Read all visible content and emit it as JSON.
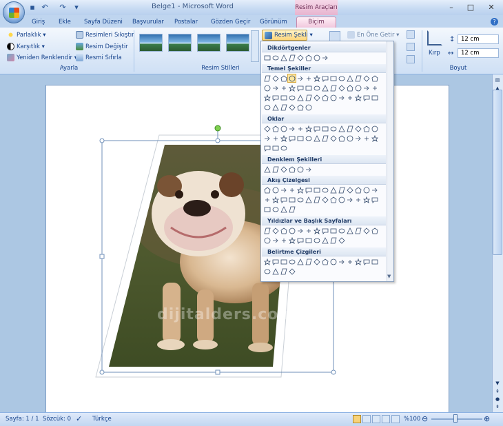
{
  "titlebar": {
    "title": "Belge1 - Microsoft Word",
    "context_group": "Resim Araçları",
    "minimize": "–",
    "maximize": "□",
    "close": "✕"
  },
  "qat": {
    "save": "▪",
    "undo": "↶",
    "redo": "↷",
    "more": "▾"
  },
  "tabs": [
    {
      "label": "Giriş"
    },
    {
      "label": "Ekle"
    },
    {
      "label": "Sayfa Düzeni"
    },
    {
      "label": "Başvurular"
    },
    {
      "label": "Postalar"
    },
    {
      "label": "Gözden Geçir"
    },
    {
      "label": "Görünüm"
    },
    {
      "label": "Biçim"
    }
  ],
  "ribbon": {
    "adjust": {
      "brightness": "Parlaklık ▾",
      "contrast": "Karşıtlık ▾",
      "recolor": "Yeniden Renklendir ▾",
      "compress": "Resimleri Sıkıştır",
      "change": "Resim Değiştir",
      "reset": "Resmi Sıfırla",
      "label": "Ayarla"
    },
    "styles": {
      "label": "Resim Stilleri"
    },
    "shape_btn": "Resim Şekli ▾",
    "arrange": {
      "bring_front": "En Öne Getir ▾"
    },
    "size": {
      "crop": "Kırp",
      "height": "12 cm",
      "width": "12 cm",
      "label": "Boyut"
    }
  },
  "shapes_menu": {
    "categories": [
      {
        "name": "Dikdörtgenler"
      },
      {
        "name": "Temel Şekiller"
      },
      {
        "name": "Oklar"
      },
      {
        "name": "Denklem Şekilleri"
      },
      {
        "name": "Akış Çizelgesi"
      },
      {
        "name": "Yıldızlar ve Başlık Sayfaları"
      },
      {
        "name": "Belirtme Çizgileri"
      }
    ]
  },
  "document": {
    "watermark": "dijitalders.com"
  },
  "statusbar": {
    "page": "Sayfa: 1 / 1",
    "words": "Sözcük: 0",
    "language": "Türkçe",
    "zoom": "%100"
  }
}
